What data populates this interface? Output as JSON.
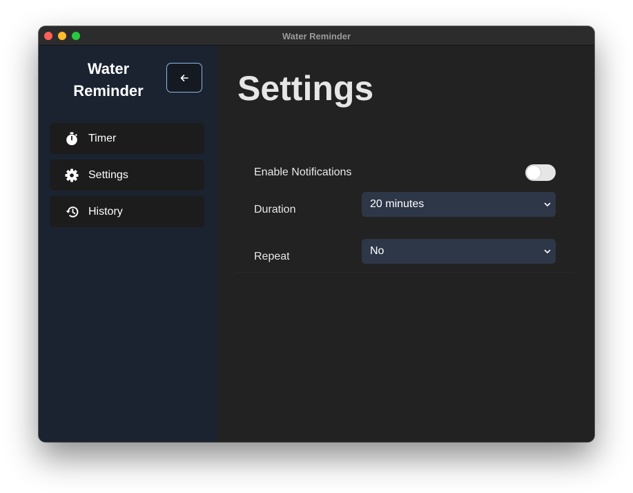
{
  "window": {
    "title": "Water Reminder"
  },
  "sidebar": {
    "app_title_line1": "Water",
    "app_title_line2": "Reminder",
    "back_button_icon": "arrow-left-icon",
    "items": [
      {
        "label": "Timer",
        "icon": "stopwatch-icon"
      },
      {
        "label": "Settings",
        "icon": "gear-icon"
      },
      {
        "label": "History",
        "icon": "history-icon"
      }
    ]
  },
  "main": {
    "title": "Settings",
    "enable_notifications": {
      "label": "Enable Notifications",
      "enabled": false
    },
    "duration": {
      "label": "Duration",
      "selected": "20 minutes"
    },
    "repeat": {
      "label": "Repeat",
      "selected": "No"
    }
  },
  "colors": {
    "sidebar_bg": "#1b2331",
    "main_bg": "#222222",
    "nav_item_bg": "#1c1c1c",
    "select_bg": "#2e3748",
    "back_button_border": "#8fb8e8"
  }
}
